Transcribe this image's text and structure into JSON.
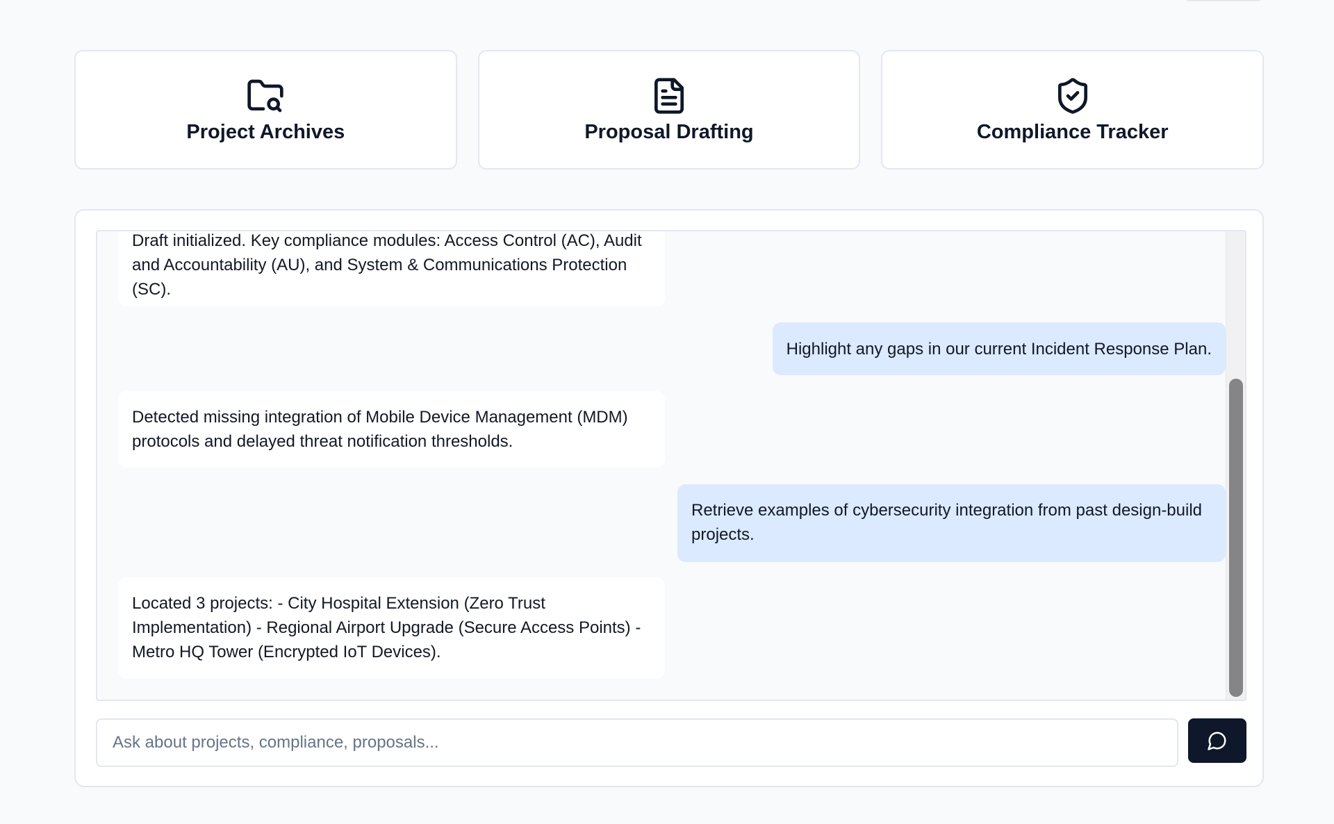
{
  "cards": [
    {
      "label": "Project Archives",
      "icon": "folder-search-icon"
    },
    {
      "label": "Proposal Drafting",
      "icon": "file-text-icon"
    },
    {
      "label": "Compliance Tracker",
      "icon": "shield-check-icon"
    }
  ],
  "chat": {
    "messages": [
      {
        "role": "assistant",
        "text": "Draft initialized. Key compliance modules: Access Control (AC), Audit and Accountability (AU), and System & Communications Protection (SC)."
      },
      {
        "role": "user",
        "text": "Highlight any gaps in our current Incident Response Plan."
      },
      {
        "role": "assistant",
        "text": "Detected missing integration of Mobile Device Management (MDM) protocols and delayed threat notification thresholds."
      },
      {
        "role": "user",
        "text": "Retrieve examples of cybersecurity integration from past design-build projects."
      },
      {
        "role": "assistant",
        "text": "Located 3 projects: - City Hospital Extension (Zero Trust Implementation) - Regional Airport Upgrade (Secure Access Points) - Metro HQ Tower (Encrypted IoT Devices)."
      }
    ],
    "input": {
      "value": "",
      "placeholder": "Ask about projects, compliance, proposals..."
    },
    "send_icon": "message-circle-icon"
  },
  "colors": {
    "user_bubble": "#dbeafe",
    "assistant_bubble": "#ffffff",
    "send_button": "#0f172a"
  }
}
